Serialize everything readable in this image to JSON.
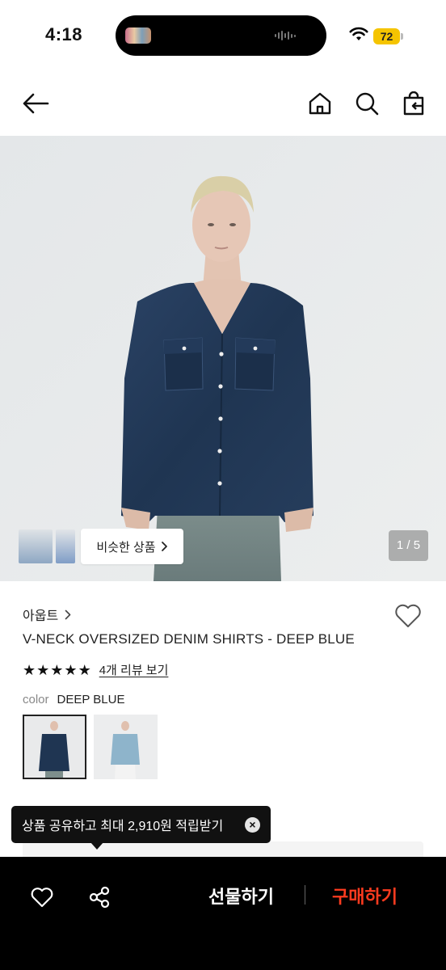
{
  "status_bar": {
    "time": "4:18",
    "battery": "72"
  },
  "nav": {
    "back_icon": "arrow-left-icon",
    "home_icon": "home-icon",
    "search_icon": "search-icon",
    "bag_icon": "shopping-bag-icon"
  },
  "gallery": {
    "similar_label": "비슷한 상품",
    "page_indicator": "1 / 5"
  },
  "product": {
    "brand": "아웁트",
    "name": "V-NECK OVERSIZED DENIM SHIRTS - DEEP BLUE",
    "rating_stars": 5,
    "review_link": "4개 리뷰 보기",
    "color_label": "color",
    "color_value": "DEEP BLUE",
    "swatches": [
      "DEEP BLUE",
      "LIGHT BLUE"
    ]
  },
  "tooltip": {
    "text": "상품 공유하고 최대 2,910원 적립받기",
    "close": "×"
  },
  "bottom_bar": {
    "gift_label": "선물하기",
    "buy_label": "구매하기"
  },
  "colors": {
    "accent_buy": "#ff3b1f",
    "battery": "#f5c400",
    "denim": "#1f3552"
  }
}
